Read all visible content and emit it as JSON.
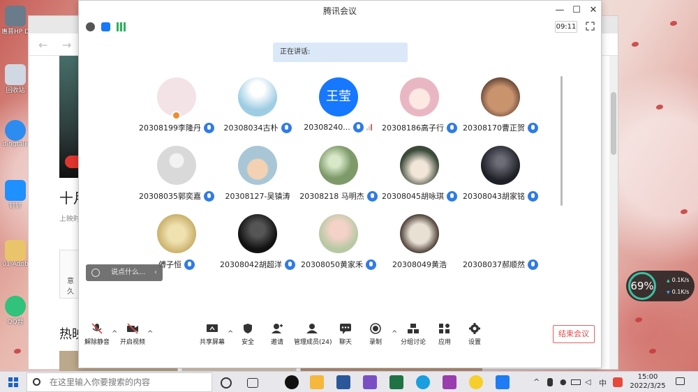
{
  "meeting": {
    "title": "腾讯会议",
    "timer": "09:11",
    "speaking_label": "正在讲话:",
    "chat_placeholder": "说点什么...",
    "members": [
      {
        "name": "20308199李隆丹",
        "avatar_color": "#f3e3e6",
        "host": true
      },
      {
        "name": "20308034古朴",
        "avatar_color": "#9ecde3"
      },
      {
        "name": "20308240...",
        "avatar_color": "#1677ff",
        "avatar_text": "王莹",
        "signal": true
      },
      {
        "name": "20308186高子行",
        "avatar_color": "#e9b7c3"
      },
      {
        "name": "20308170曹正贺",
        "avatar_color": "#9a6d55"
      },
      {
        "name": "20308035郭奕嘉",
        "avatar_color": "#d9d9d9"
      },
      {
        "name": "20308127-吴镇涛",
        "avatar_color": "#a8c6d6"
      },
      {
        "name": "20308218 马明杰",
        "avatar_color": "#7f9a6a"
      },
      {
        "name": "20308045胡咏琪",
        "avatar_color": "#d9d4c8"
      },
      {
        "name": "20308043胡家铭",
        "avatar_color": "#3b3b45"
      },
      {
        "name": "傅子恒",
        "avatar_color": "#d8c48a"
      },
      {
        "name": "20308042胡超洋",
        "avatar_color": "#2a2a2a"
      },
      {
        "name": "20308050黄家禾",
        "avatar_color": "#b7c9a4"
      },
      {
        "name": "20308049黄浩",
        "avatar_color": "#6b5a4c"
      },
      {
        "name": "20308037郝顺然",
        "avatar_color": ""
      }
    ],
    "toolbar": {
      "unmute": "解除静音",
      "start_video": "开启视频",
      "share_screen": "共享屏幕",
      "security": "安全",
      "invite": "邀请",
      "manage_members": "管理成员(24)",
      "chat": "聊天",
      "record": "录制",
      "breakout": "分组讨论",
      "apps": "应用",
      "settings": "设置",
      "end_meeting": "结束会议"
    }
  },
  "browser": {
    "title_fragment": "十月",
    "subtitle_fragment": "上映时",
    "card_label": "意久",
    "hot_label": "热映",
    "vip_badge": "会员"
  },
  "desktop": {
    "icons": [
      "惠普HP Deskjet",
      "回收站",
      "dingtalk",
      "钉钉",
      "01-Adob",
      "QQ音"
    ]
  },
  "speed_widget": {
    "percent": "69%",
    "upload": "0.1K/s",
    "download": "0.1K/s"
  },
  "taskbar": {
    "search_placeholder": "在这里输入你要搜索的内容",
    "time": "15:00",
    "date": "2022/3/25",
    "ime": "中"
  },
  "colors": {
    "accent": "#2f7be8",
    "end_button": "#e04b4b",
    "speaking_bg": "#dbe8f8"
  }
}
